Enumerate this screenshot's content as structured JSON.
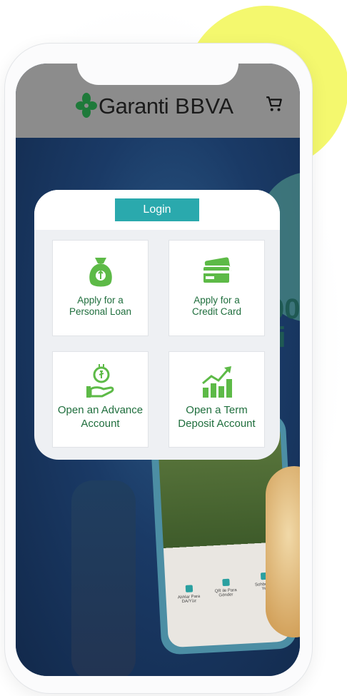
{
  "header": {
    "logo_text": "Garanti",
    "logo_text2": "BBVA",
    "cart_icon": "shopping-cart-icon"
  },
  "card": {
    "login_label": "Login",
    "tiles": [
      {
        "label": "Apply for a\nPersonal Loan",
        "icon": "money-bag-icon"
      },
      {
        "label": "Apply for a\nCredit Card",
        "icon": "credit-card-icon"
      },
      {
        "label": "Open an Advance\nAccount",
        "icon": "coin-hand-icon"
      },
      {
        "label": "Open a Term\nDeposit Account",
        "icon": "growth-chart-icon"
      }
    ]
  },
  "hero": {
    "bigtext": "00\nfi",
    "app_items": [
      "Alıhlar Para\nDA/Yüz",
      "QR ile Para Gönder",
      "Sohbet G\nYe"
    ]
  },
  "colors": {
    "accent": "#2aa9ad",
    "icon_green": "#5dba47",
    "label_green": "#1f6e3d",
    "header_gray": "#8c8c8c",
    "yellow": "#f4f86e",
    "hero_navy": "#17345b"
  }
}
